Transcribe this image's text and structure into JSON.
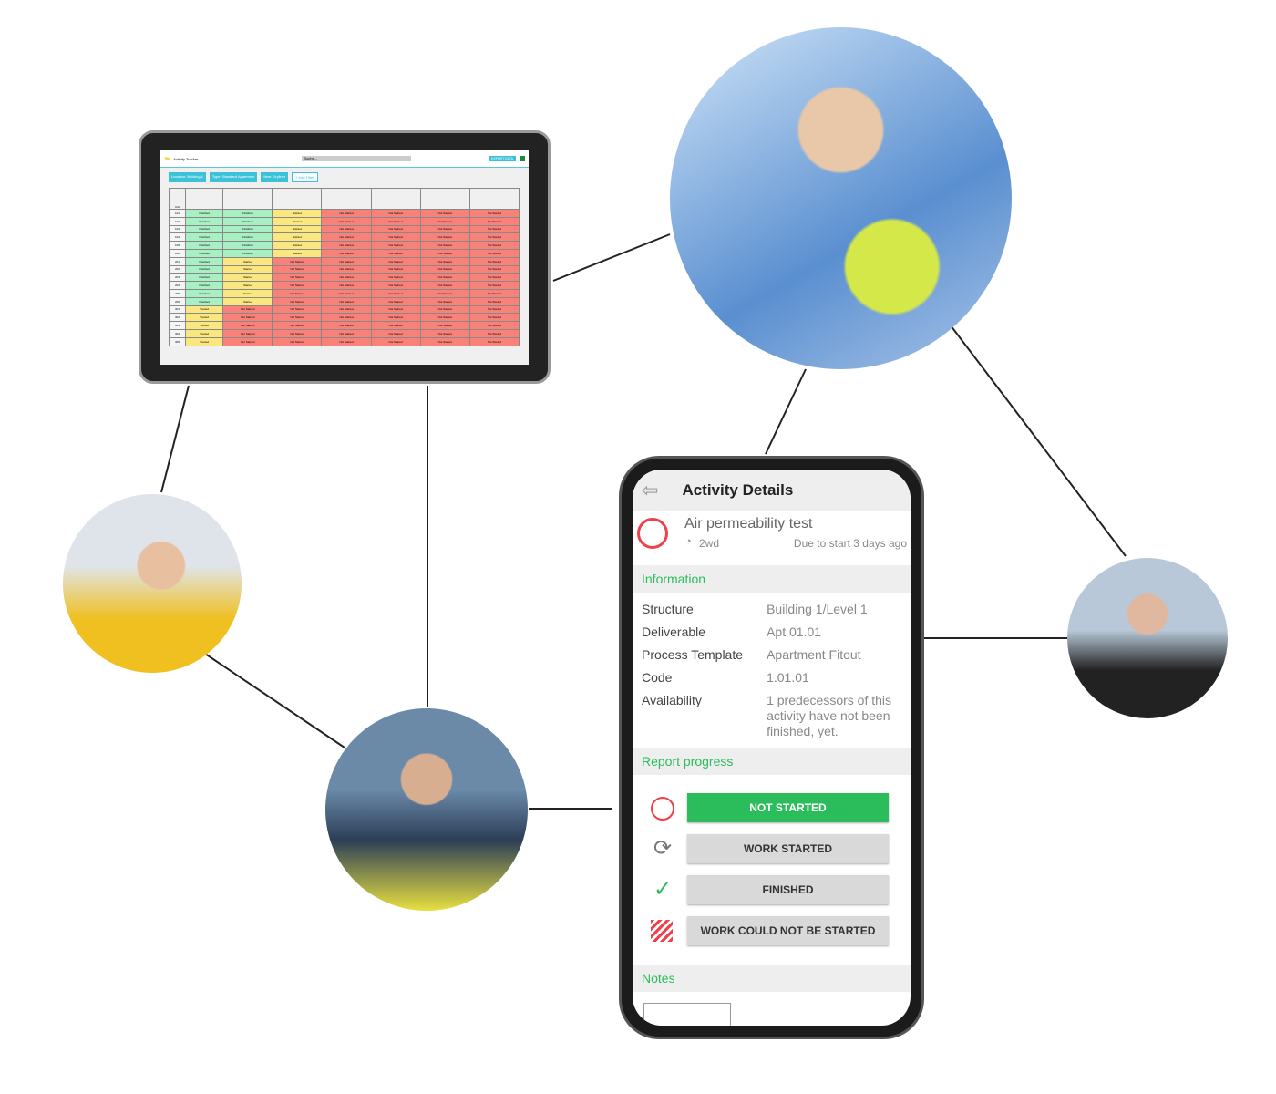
{
  "tablet": {
    "app_title": "Activity Tracker",
    "search_placeholder": "Suche...",
    "export_label": "EXPORT DATA",
    "filters": [
      "Location: Building 1",
      "Type: Standard Apartment",
      "Item: Dryliner"
    ],
    "add_filter": "+ Add Filter",
    "unit_header": "Unit",
    "status_labels": {
      "F": "Finished",
      "S": "Started",
      "N": "Not Started"
    },
    "columns": 7,
    "rows": [
      {
        "unit": "101",
        "s": "FFSNNNN"
      },
      {
        "unit": "102",
        "s": "FFSNNNN"
      },
      {
        "unit": "103",
        "s": "FFSNNNN"
      },
      {
        "unit": "104",
        "s": "FFSNNNN"
      },
      {
        "unit": "105",
        "s": "FFSNNNN"
      },
      {
        "unit": "106",
        "s": "FFSNNNN"
      },
      {
        "unit": "201",
        "s": "FSNNNNN"
      },
      {
        "unit": "202",
        "s": "FSNNNNN"
      },
      {
        "unit": "203",
        "s": "FSNNNNN"
      },
      {
        "unit": "204",
        "s": "FSNNNNN"
      },
      {
        "unit": "205",
        "s": "FSNNNNN"
      },
      {
        "unit": "206",
        "s": "FSNNNNN"
      },
      {
        "unit": "301",
        "s": "SNNNNNN"
      },
      {
        "unit": "302",
        "s": "SNNNNNN"
      },
      {
        "unit": "303",
        "s": "SNNNNNN"
      },
      {
        "unit": "304",
        "s": "SNNNNNN"
      },
      {
        "unit": "305",
        "s": "SNNNNNN"
      }
    ],
    "colors": {
      "accent": "#3cc2d8",
      "finished": "#a8efc3",
      "started": "#fbe77f",
      "not_started": "#f8827a"
    }
  },
  "phone": {
    "title": "Activity Details",
    "activity": {
      "name": "Air permeability test",
      "duration": "2wd",
      "due": "Due to start 3 days ago"
    },
    "information_label": "Information",
    "info": [
      {
        "k": "Structure",
        "v": "Building 1/Level 1"
      },
      {
        "k": "Deliverable",
        "v": "Apt 01.01"
      },
      {
        "k": "Process Template",
        "v": "Apartment Fitout"
      },
      {
        "k": "Code",
        "v": "1.01.01"
      },
      {
        "k": "Availability",
        "v": "1 predecessors of this activity have not been finished, yet."
      }
    ],
    "report_label": "Report progress",
    "buttons": [
      "NOT STARTED",
      "WORK STARTED",
      "FINISHED",
      "WORK COULD NOT BE STARTED"
    ],
    "selected": "NOT STARTED",
    "notes_label": "Notes",
    "colors": {
      "green": "#2bbd5b",
      "red": "#f0404a"
    }
  }
}
